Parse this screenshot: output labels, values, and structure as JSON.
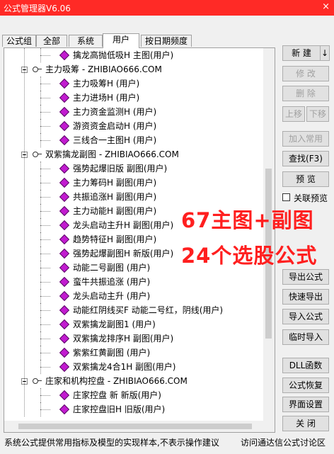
{
  "window": {
    "title": "公式管理器V6.06",
    "close_glyph": "×"
  },
  "tabs": [
    "公式组",
    "全部",
    "系统",
    "用户",
    "按日期频度"
  ],
  "tree": [
    {
      "kind": "leaf",
      "label": "擒龙高抛低吸H  主图(用户)"
    },
    {
      "kind": "group",
      "label": "主力吸筹 - ZHIBIAO666.COM"
    },
    {
      "kind": "leaf",
      "label": "主力吸筹H  (用户)"
    },
    {
      "kind": "leaf",
      "label": "主力进场H  (用户)"
    },
    {
      "kind": "leaf",
      "label": "主力资金监测H (用户)"
    },
    {
      "kind": "leaf",
      "label": "游资资金启动H (用户)"
    },
    {
      "kind": "leaf",
      "label": "三线合一主图H (用户)"
    },
    {
      "kind": "group",
      "label": "双紫擒龙副图 - ZHIBIAO666.COM"
    },
    {
      "kind": "leaf",
      "label": "强势起爆旧版  副图(用户)"
    },
    {
      "kind": "leaf",
      "label": "主力筹码H  副图(用户)"
    },
    {
      "kind": "leaf",
      "label": "共振追涨H  副图(用户)"
    },
    {
      "kind": "leaf",
      "label": "主力动能H  副图(用户)"
    },
    {
      "kind": "leaf",
      "label": "龙头启动主升H  副图(用户)"
    },
    {
      "kind": "leaf",
      "label": "趋势特征H  副图(用户)"
    },
    {
      "kind": "leaf",
      "label": "强势起爆副图H  新版(用户)"
    },
    {
      "kind": "leaf",
      "label": "动能二号副图  (用户)"
    },
    {
      "kind": "leaf",
      "label": "蛮牛共振追涨  (用户)"
    },
    {
      "kind": "leaf",
      "label": "龙头启动主升  (用户)"
    },
    {
      "kind": "leaf",
      "label": "动能红阴线买F  动能二号红，阴线(用户)"
    },
    {
      "kind": "leaf",
      "label": "双紫擒龙副图1 (用户)"
    },
    {
      "kind": "leaf",
      "label": "双紫擒龙排序H  副图(用户)"
    },
    {
      "kind": "leaf",
      "label": "紫紫红黄副图  (用户)"
    },
    {
      "kind": "leaf",
      "label": "双紫擒龙4合1H  副图(用户)"
    },
    {
      "kind": "group",
      "label": "庄家和机构控盘 - ZHIBIAO666.COM"
    },
    {
      "kind": "leaf",
      "label": "庄家控盘 新  新版(用户)"
    },
    {
      "kind": "leaf",
      "label": "庄家控盘旧H  旧版(用户)"
    }
  ],
  "buttons": {
    "new": "新  建",
    "new_arrow": "↓",
    "modify": "修  改",
    "delete": "删  除",
    "move_up": "上移",
    "move_down": "下移",
    "add_common": "加入常用",
    "find": "查找(F3)",
    "preview": "预  览",
    "related_preview": "关联预览",
    "export": "导出公式",
    "quick_export": "快速导出",
    "import": "导入公式",
    "temp_import": "临时导入",
    "dll": "DLL函数",
    "restore": "公式恢复",
    "ui_settings": "界面设置",
    "close": "关  闭"
  },
  "overlay": {
    "line1": "67主图+副图",
    "line2": "24个选股公式"
  },
  "status": {
    "left": "系统公式提供常用指标及模型的实现样本,不表示操作建议",
    "right": "访问通达信公式讨论区"
  }
}
